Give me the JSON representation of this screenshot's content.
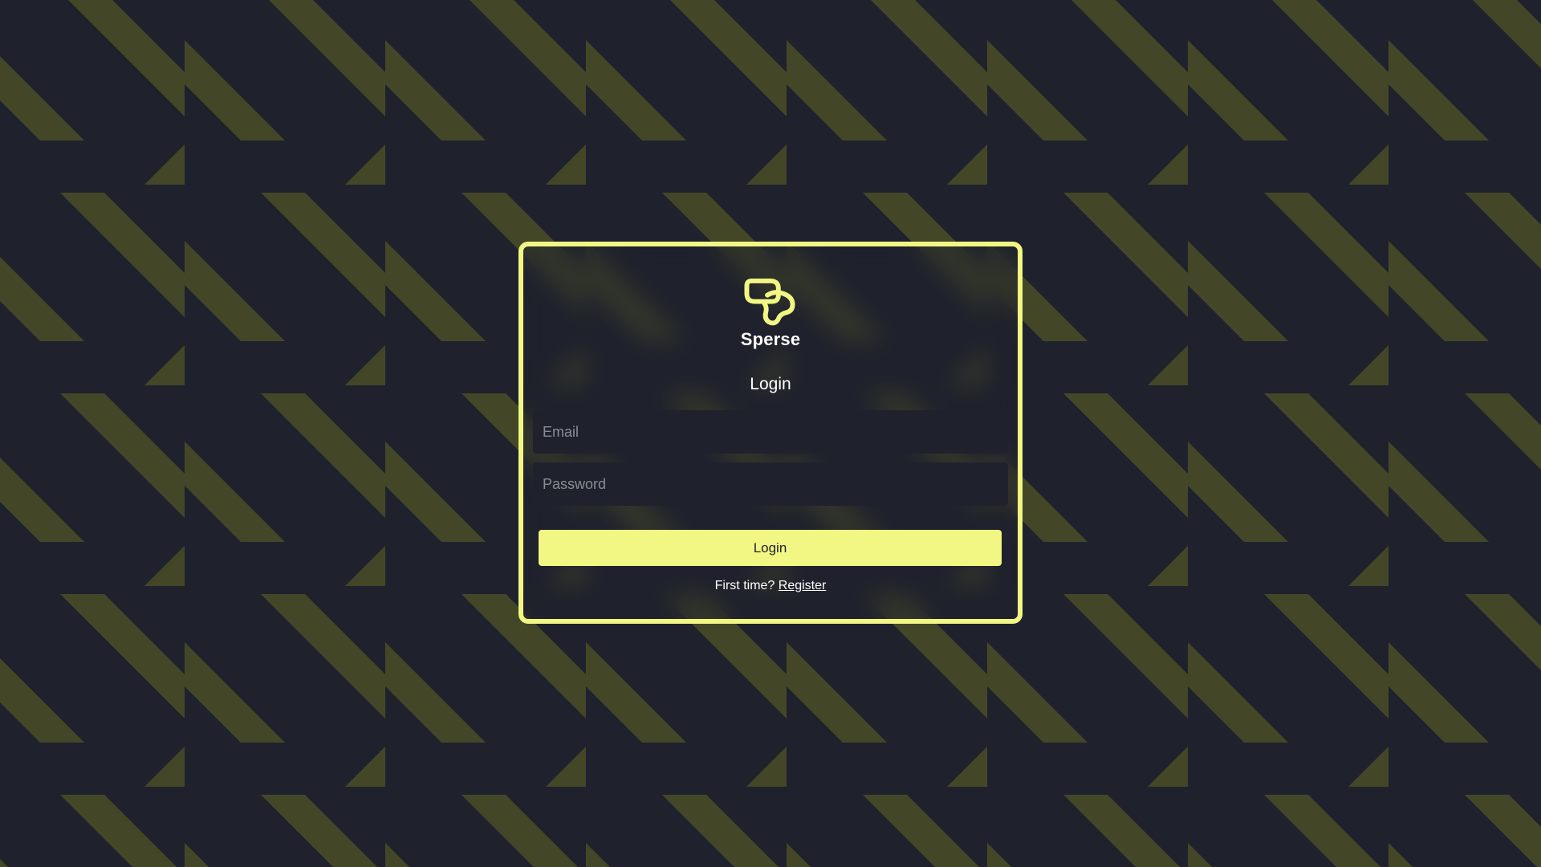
{
  "colors": {
    "background": "#1f222c",
    "stripe": "#434728",
    "accent": "#f2f784",
    "text": "#ffffff",
    "placeholder": "#8a8c94"
  },
  "brand": {
    "name": "Sperse",
    "logo_icon": "sperse-logo-icon"
  },
  "login": {
    "title": "Login",
    "email_placeholder": "Email",
    "email_value": "",
    "password_placeholder": "Password",
    "password_value": "",
    "submit_label": "Login",
    "register_prompt": "First time?",
    "register_link": "Register"
  }
}
